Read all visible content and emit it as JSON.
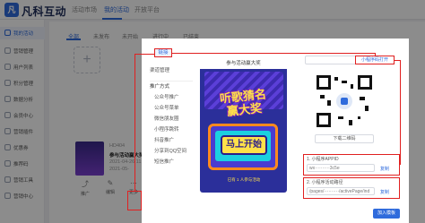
{
  "app": {
    "logo_text": "凡科互动",
    "logo_mark": "凡"
  },
  "topnav": [
    "活动市场",
    "我的活动",
    "开放平台"
  ],
  "sidebar": [
    "我的活动",
    "营销管理",
    "用户列表",
    "积分管理",
    "数据分析",
    "会员中心",
    "营销插件",
    "优惠券",
    "推荐码",
    "营销工具",
    "营销中心"
  ],
  "subtabs": [
    "全部",
    "未发布",
    "未开始",
    "进行中",
    "已结束"
  ],
  "card": {
    "id": "HD404",
    "name": "参与活动赢大奖",
    "date1": "2021-04-26 11:52",
    "date2": "2021-05-"
  },
  "card_actions": {
    "promote": "推广",
    "edit": "编辑",
    "more": "更多"
  },
  "modal": {
    "chip": "链接",
    "left_items": [
      "渠道管理",
      "推广方式",
      "公众号推广",
      "公众号菜单",
      "微信朋友圈",
      "小程序跳转",
      "抖音推广",
      "分享到QQ空间",
      "短信推广"
    ],
    "phone_title": "参与活动赢大奖",
    "poster_line1": "听歌猜名",
    "poster_line2": "赢大奖",
    "start_label": "马上开始",
    "phone_footer": "已有 1 人参与活动",
    "tab_right": "小程序码打开",
    "download": "下载二维码",
    "appid_label": "1. 小程序APPID",
    "appid_value": "wx··········3c5e",
    "path_label": "2. 小程序活动路径",
    "path_value": "/pages/··········/activePage/ind",
    "copy_label": "复制",
    "add_label": "加入模板"
  },
  "colors": {
    "accent": "#2f6bdc",
    "highlight": "#e02020"
  }
}
